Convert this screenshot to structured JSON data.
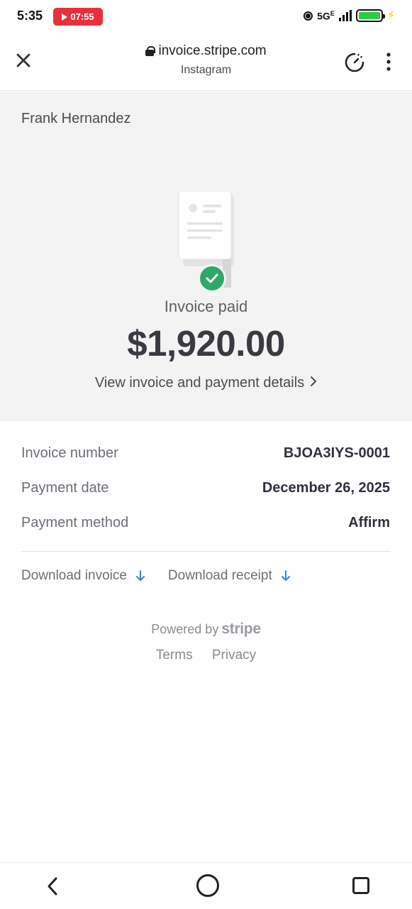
{
  "status_bar": {
    "time": "5:35",
    "recording_timer": "07:55",
    "network": "5G",
    "network_sup": "E",
    "battery_color": "#2ecc40"
  },
  "browser": {
    "url": "invoice.stripe.com",
    "source_app": "Instagram",
    "icons": [
      "close-icon",
      "lock-icon",
      "timer-icon",
      "more-vert-icon"
    ]
  },
  "invoice": {
    "merchant_name": "Frank Hernandez",
    "status": "Invoice paid",
    "amount": "$1,920.00",
    "view_details_link": "View invoice and payment details",
    "status_color": "#2ea86b"
  },
  "details": [
    {
      "label": "Invoice number",
      "value": "BJOA3IYS-0001"
    },
    {
      "label": "Payment date",
      "value": "December 26, 2025"
    },
    {
      "label": "Payment method",
      "value": "Affirm"
    }
  ],
  "downloads": {
    "invoice_label": "Download invoice",
    "receipt_label": "Download receipt",
    "arrow_color": "#3d82d6"
  },
  "footer": {
    "powered_by": "Powered by",
    "brand": "stripe",
    "terms": "Terms",
    "privacy": "Privacy"
  }
}
